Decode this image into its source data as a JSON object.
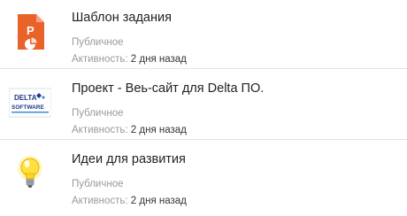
{
  "items": [
    {
      "title": "Шаблон задания",
      "visibility": "Публичное",
      "activity_label": "Активность:",
      "activity_value": "2 дня назад",
      "icon": "presentation-file-icon",
      "logo_text": "P"
    },
    {
      "title": "Проект - Веь-сайт для Delta ПО.",
      "visibility": "Публичное",
      "activity_label": "Активность:",
      "activity_value": "2 дня назад",
      "icon": "delta-software-logo",
      "logo_text": [
        "DELTA",
        "SOFTWARE"
      ]
    },
    {
      "title": "Идеи для развития",
      "visibility": "Публичное",
      "activity_label": "Активность:",
      "activity_value": "2 дня назад",
      "icon": "lightbulb-icon"
    }
  ],
  "colors": {
    "presentation_orange": "#e8622a",
    "logo_blue": "#1a3a8a",
    "bulb_yellow": "#ffe040"
  }
}
